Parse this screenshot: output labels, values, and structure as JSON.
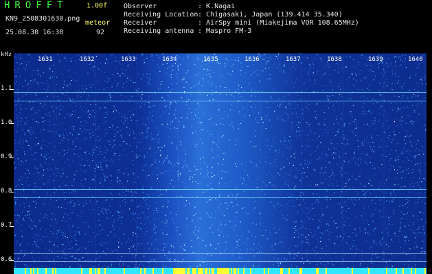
{
  "header": {
    "title": "HROFFT",
    "version": "1.00f",
    "filename": "KN9_2508301630.png",
    "meteor_label": "meteor",
    "datetime": "25.08.30 16:30",
    "meteor_count": "92",
    "info": [
      {
        "label": "Observer",
        "value": ": K.Nagai"
      },
      {
        "label": "Receiving Location",
        "value": ": Chigasaki, Japan (139.414 35.340)"
      },
      {
        "label": "Receiver",
        "value": ": AirSpy mini (Miakejima VOR 108.65MHz)"
      },
      {
        "label": "Receiving antenna",
        "value": ": Maspro FM-3"
      }
    ]
  },
  "axes": {
    "y_unit": "kHz",
    "y_labels": [
      "1.1",
      "1.0",
      "0.9",
      "0.8",
      "0.7",
      "0.6"
    ],
    "x_labels": [
      "1631",
      "1632",
      "1633",
      "1634",
      "1635",
      "1636",
      "1637",
      "1638",
      "1639",
      "1640"
    ]
  },
  "colors": {
    "header_green": "#3cff3c",
    "header_yellow": "#ffff66",
    "spectrum_blue": "#1b4fc0",
    "line_cyan": "#8ff7ff"
  }
}
